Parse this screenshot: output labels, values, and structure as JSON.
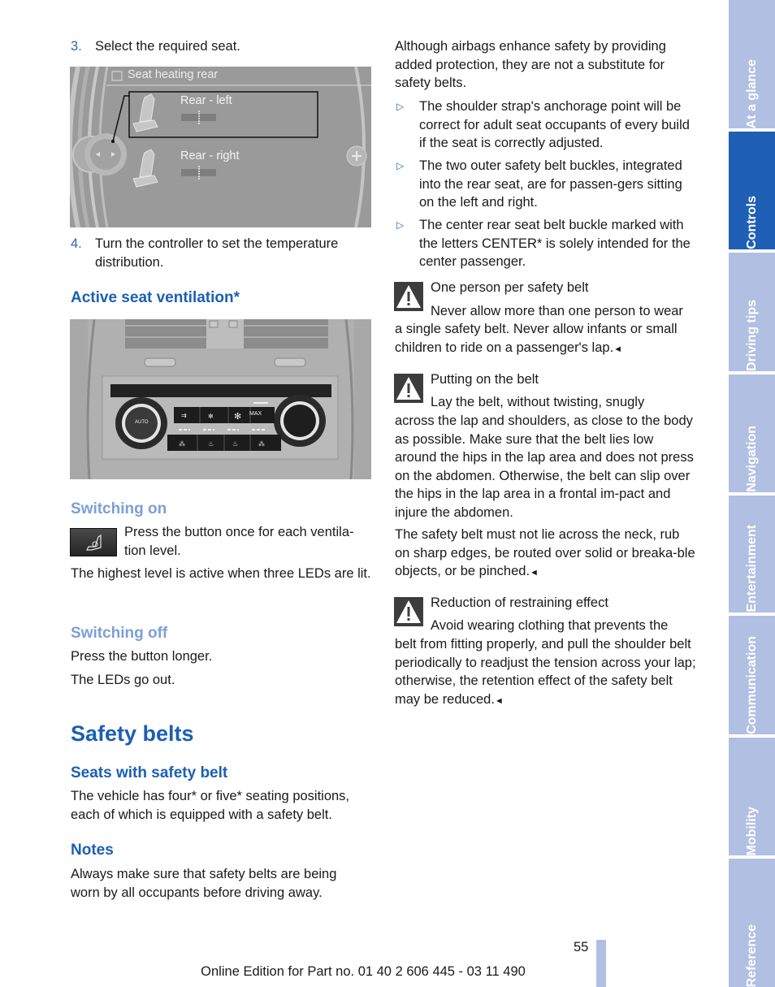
{
  "left": {
    "step3": {
      "num": "3.",
      "text": "Select the required seat."
    },
    "figure1": {
      "title": "Seat heating rear",
      "items": [
        {
          "label": "Rear - left",
          "level": 0.5
        },
        {
          "label": "Rear - right",
          "level": 0.5
        }
      ]
    },
    "step4": {
      "num": "4.",
      "text": "Turn the controller to set the temperature distribution."
    },
    "ventilation_heading": "Active seat ventilation*",
    "figure2": {
      "auto_label": "AUTO",
      "max_label": "MAX"
    },
    "switching_on": {
      "heading": "Switching on",
      "text": "Press the button once for each ventila-tion level.",
      "text_line1": "Press the button once for each ventila-",
      "text_line2": "tion level.",
      "note": "The highest level is active when three LEDs are lit."
    },
    "switching_off": {
      "heading": "Switching off",
      "text1": "Press the button longer.",
      "text2": "The LEDs go out."
    },
    "safety_belts_heading": "Safety belts",
    "seats_heading": "Seats with safety belt",
    "seats_text": "The vehicle has four* or five* seating positions, each of which is equipped with a safety belt.",
    "notes_heading": "Notes",
    "notes_text": "Always make sure that safety belts are being worn by all occupants before driving away."
  },
  "right": {
    "intro": "Although airbags enhance safety by providing added protection, they are not a substitute for safety belts.",
    "bullets": [
      "The shoulder strap's anchorage point will be correct for adult seat occupants of every build if the seat is correctly adjusted.",
      "The two outer safety belt buckles, integrated into the rear seat, are for passen-gers sitting on the left and right.",
      "The center rear seat belt buckle marked with the letters CENTER* is solely intended for the center passenger."
    ],
    "warnings": [
      {
        "title": "One person per safety belt",
        "first_line": "Never allow more than one person to wear",
        "rest": "a single safety belt. Never allow infants or small children to ride on a passenger's lap."
      },
      {
        "title": "Putting on the belt",
        "first_line": "Lay the belt, without twisting, snugly",
        "rest": "across the lap and shoulders, as close to the body as possible. Make sure that the belt lies low around the hips in the lap area and does not press on the abdomen. Otherwise, the belt can slip over the hips in the lap area in a frontal im-pact and injure the abdomen."
      },
      {
        "title": "Reduction of restraining effect",
        "first_line": "Avoid wearing clothing that prevents the",
        "rest": "belt from fitting properly, and pull the shoulder belt periodically to readjust the tension across your lap; otherwise, the retention effect of the safety belt may be reduced."
      }
    ],
    "warning2_extra": "The safety belt must not lie across the neck, rub on sharp edges, be routed over solid or breaka-ble objects, or be pinched.",
    "end_mark": "◄"
  },
  "sidebar": {
    "tabs": [
      {
        "label": "At a glance",
        "active": false
      },
      {
        "label": "Controls",
        "active": true
      },
      {
        "label": "Driving tips",
        "active": false
      },
      {
        "label": "Navigation",
        "active": false
      },
      {
        "label": "Entertainment",
        "active": false
      },
      {
        "label": "Communication",
        "active": false
      },
      {
        "label": "Mobility",
        "active": false
      },
      {
        "label": "Reference",
        "active": false
      }
    ]
  },
  "footer": {
    "page_number": "55",
    "edition": "Online Edition for Part no. 01 40 2 606 445 - 03 11 490"
  },
  "colors": {
    "heading_blue": "#1c5fb3",
    "subheading_light_blue": "#7d9fd8",
    "tab_inactive": "#b1c0e2",
    "tab_active": "#1f5fb5"
  }
}
